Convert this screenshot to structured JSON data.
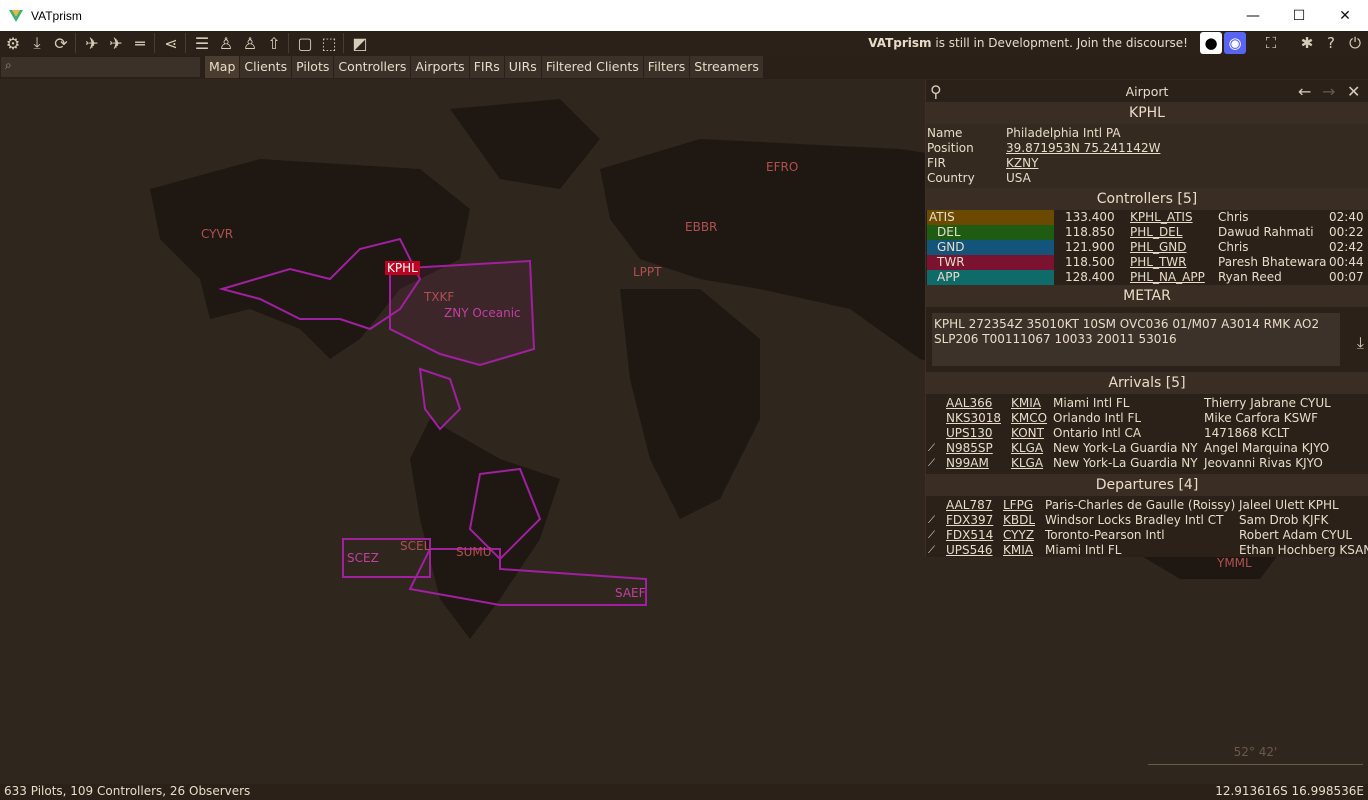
{
  "window": {
    "title": "VATprism",
    "minimize": "—",
    "maximize": "☐",
    "close": "✕"
  },
  "toolbar": {
    "icons": [
      "gear-icon",
      "download-icon",
      "refresh-icon",
      "plane-icon",
      "plane-label-icon",
      "runway-icon",
      "share-icon",
      "filter-icon",
      "person-icon",
      "person-label-icon",
      "tower-icon",
      "map-outline-icon",
      "map-dashed-icon",
      "map-alt-icon"
    ],
    "dev_note_bold": "VATprism",
    "dev_note_rest": " is still in Development. Join the discourse!"
  },
  "search": {
    "icon": "search-icon",
    "value": ""
  },
  "tabs": [
    "Map",
    "Clients",
    "Pilots",
    "Controllers",
    "Airports",
    "FIRs",
    "UIRs",
    "Filtered Clients",
    "Filters",
    "Streamers"
  ],
  "map_labels": [
    "CYVR",
    "EFRO",
    "EBBR",
    "LPPT",
    "TXKF",
    "ZNY Oceanic",
    "SCEZ",
    "SCEL",
    "SUMU",
    "SAEF",
    "YMML",
    "KPHL"
  ],
  "scale_text": "52° 42'",
  "status": {
    "left": "633 Pilots, 109 Controllers, 26 Observers",
    "right": "12.913616S 16.998536E"
  },
  "panel": {
    "header": "Airport",
    "icao": "KPHL",
    "info": [
      {
        "k": "Name",
        "v": "Philadelphia Intl PA",
        "link": false
      },
      {
        "k": "Position",
        "v": "39.871953N 75.241142W",
        "link": true
      },
      {
        "k": "FIR",
        "v": "KZNY",
        "link": true
      },
      {
        "k": "Country",
        "v": "USA",
        "link": false
      }
    ],
    "controllers_title": "Controllers [5]",
    "controllers": [
      {
        "type": "ATIS",
        "color": "#6b4a00",
        "freq": "133.400",
        "callsign": "KPHL_ATIS",
        "name": "Chris",
        "time": "02:40"
      },
      {
        "type": "DEL",
        "color": "#1d5c12",
        "freq": "118.850",
        "callsign": "PHL_DEL",
        "name": "Dawud Rahmati",
        "time": "00:22"
      },
      {
        "type": "GND",
        "color": "#12547a",
        "freq": "121.900",
        "callsign": "PHL_GND",
        "name": "Chris",
        "time": "02:42"
      },
      {
        "type": "TWR",
        "color": "#7a1230",
        "freq": "118.500",
        "callsign": "PHL_TWR",
        "name": "Paresh Bhatewara",
        "time": "00:44"
      },
      {
        "type": "APP",
        "color": "#0f6a6a",
        "freq": "128.400",
        "callsign": "PHL_NA_APP",
        "name": "Ryan Reed",
        "time": "00:07"
      }
    ],
    "metar_title": "METAR",
    "metar": "KPHL 272354Z 35010KT 10SM OVC036 01/M07 A3014 RMK AO2 SLP206 T00111067 10033 20011 53016",
    "arrivals_title": "Arrivals [5]",
    "arrivals": [
      {
        "cs": "AAL366",
        "ap": "KMIA",
        "apname": "Miami Intl FL",
        "pilot": "Thierry Jabrane CYUL",
        "tag": false
      },
      {
        "cs": "NKS3018",
        "ap": "KMCO",
        "apname": "Orlando Intl FL",
        "pilot": "Mike Carfora KSWF",
        "tag": false
      },
      {
        "cs": "UPS130",
        "ap": "KONT",
        "apname": "Ontario Intl CA",
        "pilot": "1471868 KCLT",
        "tag": false
      },
      {
        "cs": "N985SP",
        "ap": "KLGA",
        "apname": "New York-La Guardia NY",
        "pilot": "Angel Marquina KJYO",
        "tag": true
      },
      {
        "cs": "N99AM",
        "ap": "KLGA",
        "apname": "New York-La Guardia NY",
        "pilot": "Jeovanni Rivas KJYO",
        "tag": true
      }
    ],
    "departures_title": "Departures [4]",
    "departures": [
      {
        "cs": "AAL787",
        "ap": "LFPG",
        "apname": "Paris-Charles de Gaulle (Roissy)",
        "pilot": "Jaleel Ulett KPHL",
        "tag": false
      },
      {
        "cs": "FDX397",
        "ap": "KBDL",
        "apname": "Windsor Locks Bradley Intl CT",
        "pilot": "Sam Drob KJFK",
        "tag": true
      },
      {
        "cs": "FDX514",
        "ap": "CYYZ",
        "apname": "Toronto-Pearson Intl",
        "pilot": "Robert Adam CYUL",
        "tag": true
      },
      {
        "cs": "UPS546",
        "ap": "KMIA",
        "apname": "Miami Intl FL",
        "pilot": "Ethan Hochberg KSAN",
        "tag": true
      }
    ]
  }
}
